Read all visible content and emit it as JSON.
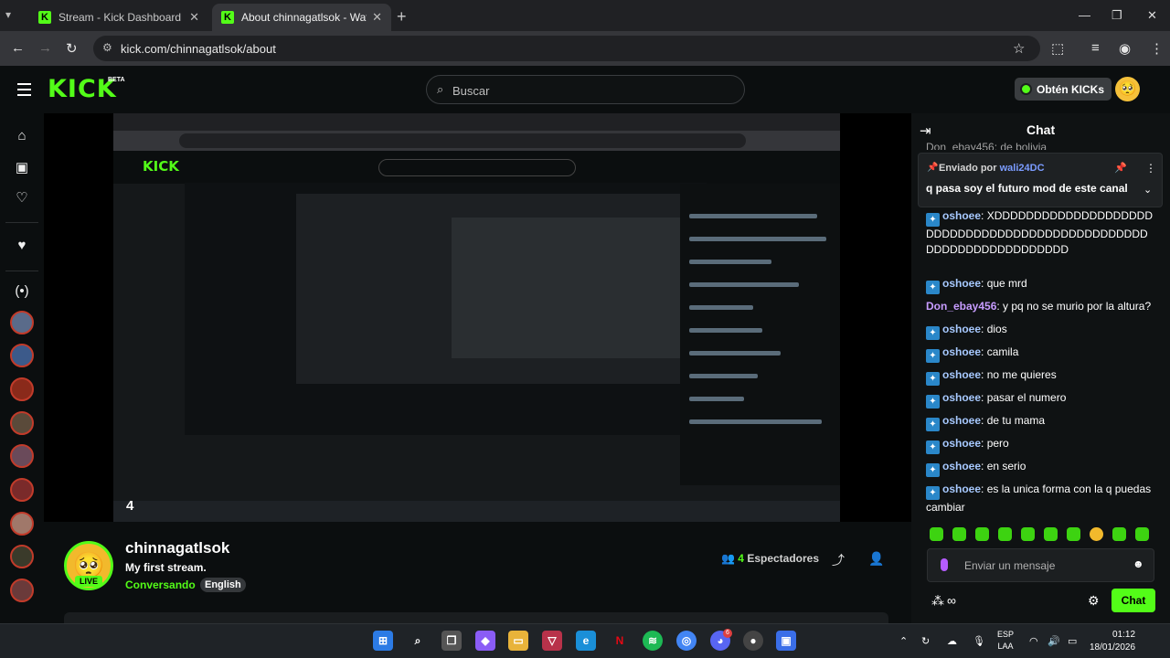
{
  "browser": {
    "tabs": [
      {
        "title": "Stream - Kick Dashboard",
        "active": false
      },
      {
        "title": "About chinnagatlsok - Watch Li",
        "active": true
      }
    ],
    "url": "kick.com/chinnagatlsok/about"
  },
  "header": {
    "logo": "KICK",
    "logo_tag": "BETA",
    "search_placeholder": "Buscar",
    "kicks_button": "Obtén KICKs"
  },
  "sidebar": {
    "nav_icons": [
      "home-icon",
      "browse-icon",
      "following-icon",
      "favorites-icon",
      "live-icon"
    ],
    "followed_avatars": 9
  },
  "stream": {
    "overlay_number": "4",
    "overlay_number_bottom": "4",
    "streamer": "chinnagatlsok",
    "live_label": "LIVE",
    "title": "My first stream.",
    "category": "Conversando",
    "tag": "English",
    "viewer_count": "4",
    "viewer_label": "Espectadores"
  },
  "chat": {
    "title": "Chat",
    "truncated_line": "Don_ebay456: de bolivia",
    "pinned": {
      "by_label": "Enviado por",
      "user": "wali24DC",
      "message": "q pasa soy el futuro mod de este canal"
    },
    "messages": [
      {
        "user": "oshoee",
        "text": "XDDDDDDDDDDDDDDDDDDDDDDDDDDDDDDDDDDDDDDDDDDDDDDDDDDDDDDDDDDDDDDDDDD",
        "badge": true,
        "color": "blue"
      },
      {
        "user": "oshoee",
        "text": "que mrd",
        "badge": true,
        "color": "blue"
      },
      {
        "user": "Don_ebay456",
        "text": "y pq no se murio por la altura?",
        "badge": false,
        "color": "purple"
      },
      {
        "user": "oshoee",
        "text": "dios",
        "badge": true,
        "color": "blue"
      },
      {
        "user": "oshoee",
        "text": "camila",
        "badge": true,
        "color": "blue"
      },
      {
        "user": "oshoee",
        "text": "no me quieres",
        "badge": true,
        "color": "blue"
      },
      {
        "user": "oshoee",
        "text": "pasar el numero",
        "badge": true,
        "color": "blue"
      },
      {
        "user": "oshoee",
        "text": "de tu mama",
        "badge": true,
        "color": "blue"
      },
      {
        "user": "oshoee",
        "text": "pero",
        "badge": true,
        "color": "blue"
      },
      {
        "user": "oshoee",
        "text": "en serio",
        "badge": true,
        "color": "blue"
      },
      {
        "user": "oshoee",
        "text": "es la unica forma con la q puedas cambiar",
        "badge": true,
        "color": "blue"
      }
    ],
    "input_placeholder": "Enviar un mensaje",
    "send_label": "Chat",
    "infinity": "∞"
  },
  "taskbar": {
    "lang_top": "ESP",
    "lang_bottom": "LAA",
    "time": "01:12",
    "date": "18/01/2026",
    "discord_badge": "6"
  },
  "colors": {
    "accent": "#53fc18",
    "background": "#0b0e0f",
    "chat_username": "#a7c9ff"
  }
}
